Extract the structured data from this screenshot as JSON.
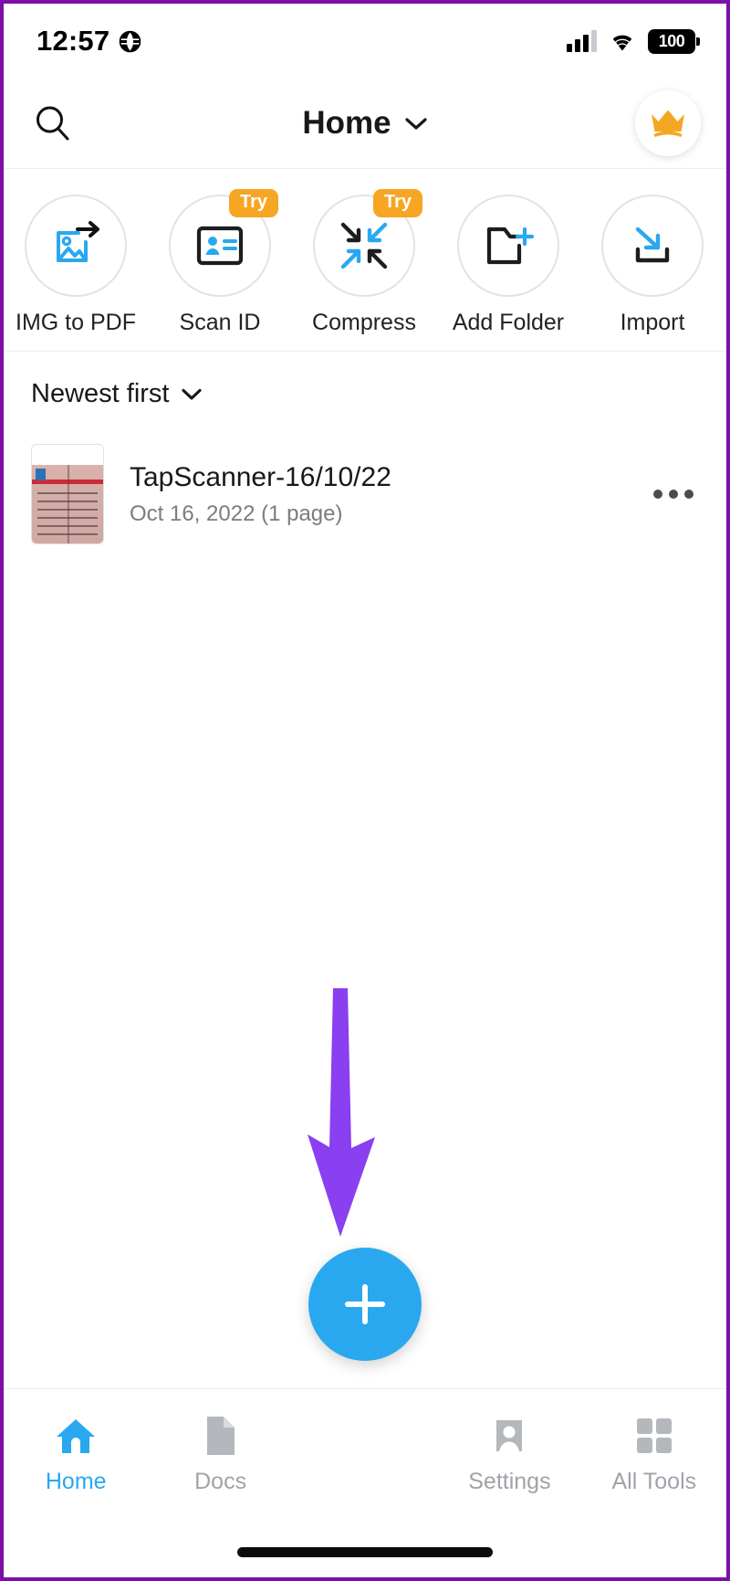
{
  "status_bar": {
    "time": "12:57",
    "globe_icon": "globe-icon",
    "signal_icon": "cellular-signal-icon",
    "wifi_icon": "wifi-icon",
    "battery_level": "100"
  },
  "header": {
    "search_icon": "search-icon",
    "title": "Home",
    "dropdown_icon": "chevron-down-icon",
    "premium_icon": "crown-icon"
  },
  "tools": [
    {
      "label": "IMG to PDF",
      "icon": "image-to-pdf-icon",
      "badge": ""
    },
    {
      "label": "Scan ID",
      "icon": "id-card-icon",
      "badge": "Try"
    },
    {
      "label": "Compress",
      "icon": "compress-arrows-icon",
      "badge": "Try"
    },
    {
      "label": "Add Folder",
      "icon": "folder-plus-icon",
      "badge": ""
    },
    {
      "label": "Import",
      "icon": "import-download-icon",
      "badge": ""
    }
  ],
  "sort": {
    "label": "Newest first",
    "icon": "chevron-down-icon"
  },
  "documents": [
    {
      "title": "TapScanner-16/10/22",
      "subtitle": "Oct 16, 2022 (1 page)",
      "thumbnail": "scanned-document-thumbnail",
      "more_icon": "more-options-icon"
    }
  ],
  "fab": {
    "icon": "plus-icon",
    "color": "#29A8F0"
  },
  "annotation": {
    "arrow_icon": "pointer-arrow-icon",
    "color": "#8A3FF0"
  },
  "bottom_nav": [
    {
      "label": "Home",
      "icon": "home-icon",
      "active": true
    },
    {
      "label": "Docs",
      "icon": "document-icon",
      "active": false
    },
    {
      "label": "Settings",
      "icon": "person-icon",
      "active": false
    },
    {
      "label": "All Tools",
      "icon": "grid-icon",
      "active": false
    }
  ],
  "colors": {
    "accent_blue": "#29A8F0",
    "badge_orange": "#F6A623",
    "crown_gold": "#F5A623",
    "annotation_purple": "#8A3FF0",
    "frame_purple": "#7B0FA8"
  }
}
